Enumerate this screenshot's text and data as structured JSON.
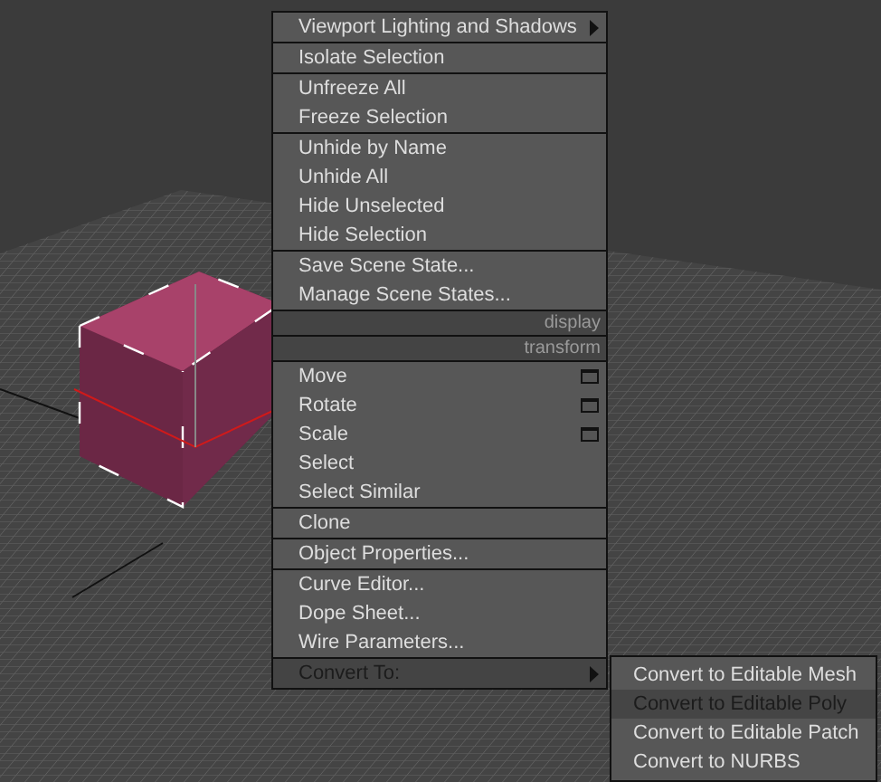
{
  "menu": {
    "sections": [
      {
        "items": [
          {
            "label": "Viewport Lighting and Shadows",
            "kind": "submenu",
            "selected": false
          }
        ]
      },
      {
        "items": [
          {
            "label": "Isolate Selection",
            "kind": "item",
            "selected": false
          }
        ]
      },
      {
        "items": [
          {
            "label": "Unfreeze All",
            "kind": "item",
            "selected": false
          },
          {
            "label": "Freeze Selection",
            "kind": "item",
            "selected": false
          }
        ]
      },
      {
        "items": [
          {
            "label": "Unhide by Name",
            "kind": "item",
            "selected": false
          },
          {
            "label": "Unhide All",
            "kind": "item",
            "selected": false
          },
          {
            "label": "Hide Unselected",
            "kind": "item",
            "selected": false
          },
          {
            "label": "Hide Selection",
            "kind": "item",
            "selected": false
          }
        ]
      },
      {
        "items": [
          {
            "label": "Save Scene State...",
            "kind": "item",
            "selected": false
          },
          {
            "label": "Manage Scene States...",
            "kind": "item",
            "selected": false
          }
        ]
      },
      {
        "items": [
          {
            "label": "display",
            "kind": "header",
            "selected": false
          }
        ]
      },
      {
        "items": [
          {
            "label": "transform",
            "kind": "header",
            "selected": false
          }
        ]
      },
      {
        "items": [
          {
            "label": "Move",
            "kind": "option",
            "selected": false
          },
          {
            "label": "Rotate",
            "kind": "option",
            "selected": false
          },
          {
            "label": "Scale",
            "kind": "option",
            "selected": false
          },
          {
            "label": "Select",
            "kind": "item",
            "selected": false
          },
          {
            "label": "Select Similar",
            "kind": "item",
            "selected": false
          }
        ]
      },
      {
        "items": [
          {
            "label": "Clone",
            "kind": "item",
            "selected": false
          }
        ]
      },
      {
        "items": [
          {
            "label": "Object Properties...",
            "kind": "item",
            "selected": false
          }
        ]
      },
      {
        "items": [
          {
            "label": "Curve Editor...",
            "kind": "item",
            "selected": false
          },
          {
            "label": "Dope Sheet...",
            "kind": "item",
            "selected": false
          },
          {
            "label": "Wire Parameters...",
            "kind": "item",
            "selected": false
          }
        ]
      },
      {
        "items": [
          {
            "label": "Convert To:",
            "kind": "submenu",
            "selected": true
          }
        ]
      }
    ]
  },
  "submenu": {
    "items": [
      {
        "label": "Convert to Editable Mesh",
        "selected": false
      },
      {
        "label": "Convert to Editable Poly",
        "selected": true
      },
      {
        "label": "Convert to Editable Patch",
        "selected": false
      },
      {
        "label": "Convert to NURBS",
        "selected": false
      }
    ]
  }
}
